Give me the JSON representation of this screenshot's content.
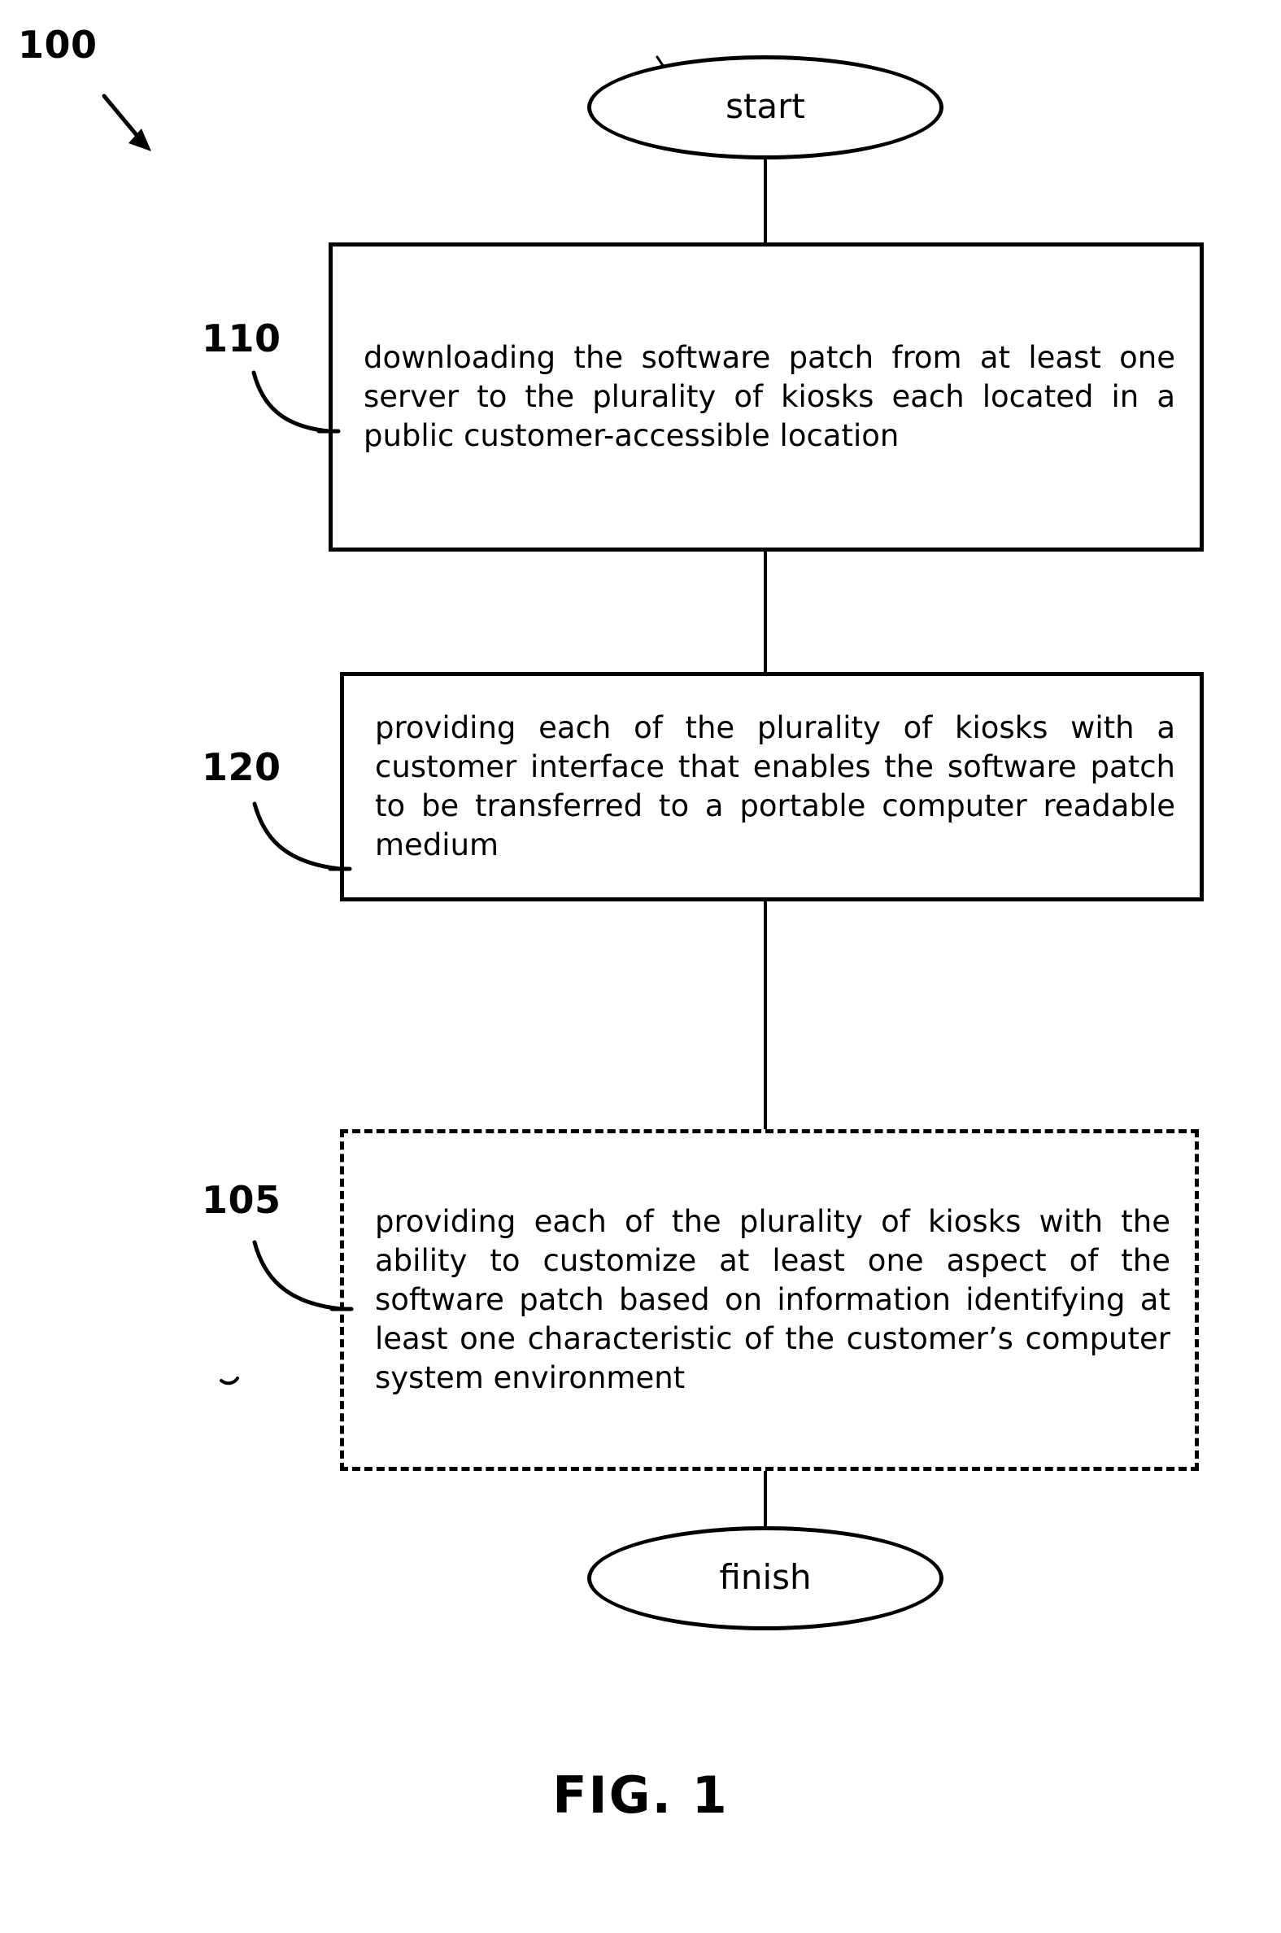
{
  "figure": {
    "caption": "FIG. 1",
    "figure_number_label": "100"
  },
  "nodes": {
    "start": {
      "label": "start",
      "shape": "oval",
      "ref": ""
    },
    "step_110": {
      "ref": "110",
      "shape": "rectangle",
      "border_style": "solid",
      "text": "downloading the software patch from at least one server to the plurality of kiosks each located in a public customer-accessible location"
    },
    "step_120": {
      "ref": "120",
      "shape": "rectangle",
      "border_style": "solid",
      "text": "providing each of the plurality of kiosks with a customer interface that enables the software patch to be transferred to a portable computer readable medium"
    },
    "step_105": {
      "ref": "105",
      "shape": "rectangle",
      "border_style": "dashed",
      "text": "providing each of the plurality of kiosks with the ability to customize at least one aspect of the software patch based on information identifying at least one characteristic of the customer’s computer system environment"
    },
    "finish": {
      "label": "finish",
      "shape": "oval",
      "ref": ""
    }
  },
  "flow": {
    "edges": [
      {
        "from": "start",
        "to": "step_110"
      },
      {
        "from": "step_110",
        "to": "step_120"
      },
      {
        "from": "step_120",
        "to": "step_105"
      },
      {
        "from": "step_105",
        "to": "finish"
      }
    ]
  },
  "colors": {
    "ink": "#000000",
    "page": "#ffffff"
  }
}
